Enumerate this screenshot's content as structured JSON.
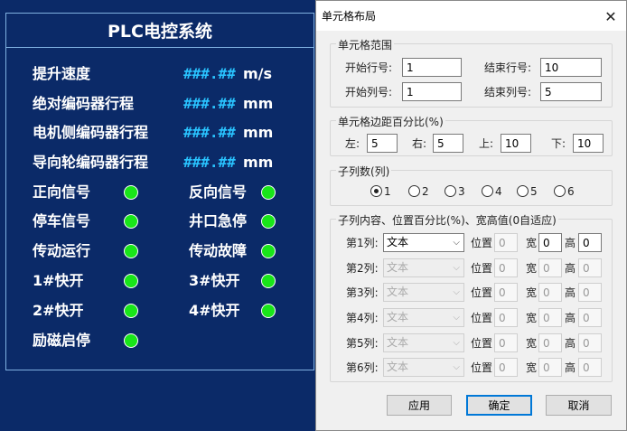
{
  "plc": {
    "title": "PLC电控系统",
    "measurements": [
      {
        "label": "提升速度",
        "value": "###.##",
        "unit": "m/s"
      },
      {
        "label": "绝对编码器行程",
        "value": "###.##",
        "unit": "mm"
      },
      {
        "label": "电机侧编码器行程",
        "value": "###.##",
        "unit": "mm"
      },
      {
        "label": "导向轮编码器行程",
        "value": "###.##",
        "unit": "mm"
      }
    ],
    "signals": [
      {
        "left": "正向信号",
        "right": "反向信号"
      },
      {
        "left": "停车信号",
        "right": "井口急停"
      },
      {
        "left": "传动运行",
        "right": "传动故障"
      },
      {
        "left": "1#快开",
        "right": "3#快开"
      },
      {
        "left": "2#快开",
        "right": "4#快开"
      },
      {
        "left": "励磁启停",
        "right": ""
      }
    ],
    "led_color": "#19e619"
  },
  "dialog": {
    "title": "单元格布局",
    "close": "✕",
    "range": {
      "legend": "单元格范围",
      "start_row_label": "开始行号:",
      "start_row": "1",
      "end_row_label": "结束行号:",
      "end_row": "10",
      "start_col_label": "开始列号:",
      "start_col": "1",
      "end_col_label": "结束列号:",
      "end_col": "5"
    },
    "margin": {
      "legend": "单元格边距百分比(%)",
      "left_label": "左:",
      "left": "5",
      "right_label": "右:",
      "right": "5",
      "top_label": "上:",
      "top": "10",
      "bottom_label": "下:",
      "bottom": "10"
    },
    "subcols": {
      "legend": "子列数(列)",
      "options": [
        "1",
        "2",
        "3",
        "4",
        "5",
        "6"
      ],
      "selected": "1"
    },
    "content": {
      "legend": "子列内容、位置百分比(%)、宽高值(0自适应)",
      "pos_label": "位置",
      "width_label": "宽",
      "height_label": "高",
      "rows": [
        {
          "label": "第1列:",
          "type": "文本",
          "pos": "0",
          "width": "0",
          "height": "0",
          "enabled": true
        },
        {
          "label": "第2列:",
          "type": "文本",
          "pos": "0",
          "width": "0",
          "height": "0",
          "enabled": false
        },
        {
          "label": "第3列:",
          "type": "文本",
          "pos": "0",
          "width": "0",
          "height": "0",
          "enabled": false
        },
        {
          "label": "第4列:",
          "type": "文本",
          "pos": "0",
          "width": "0",
          "height": "0",
          "enabled": false
        },
        {
          "label": "第5列:",
          "type": "文本",
          "pos": "0",
          "width": "0",
          "height": "0",
          "enabled": false
        },
        {
          "label": "第6列:",
          "type": "文本",
          "pos": "0",
          "width": "0",
          "height": "0",
          "enabled": false
        }
      ]
    },
    "buttons": {
      "apply": "应用",
      "ok": "确定",
      "cancel": "取消"
    }
  }
}
